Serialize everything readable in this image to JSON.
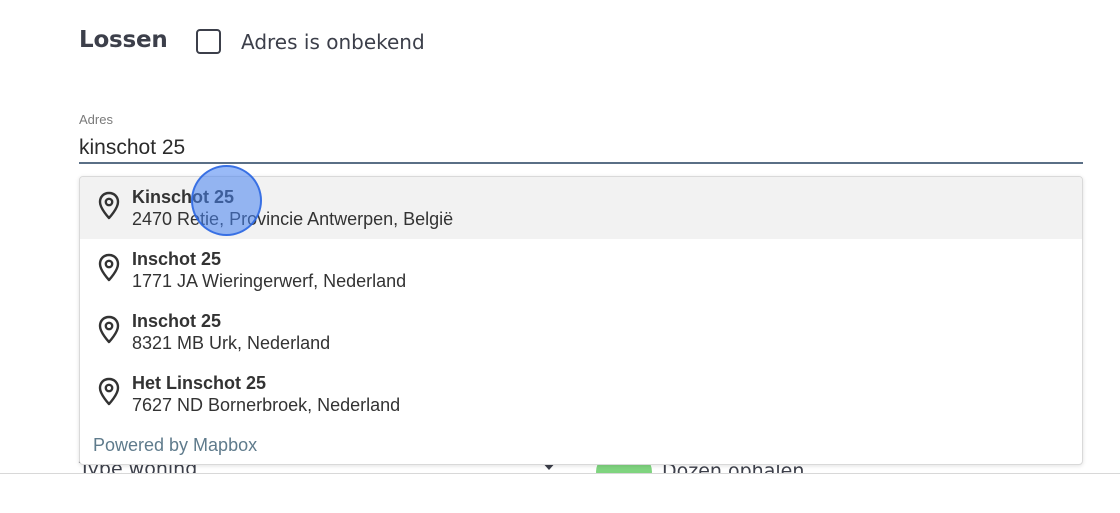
{
  "section": {
    "title": "Lossen",
    "unknown_address_label": "Adres is onbekend",
    "unknown_address_checked": false
  },
  "address": {
    "label": "Adres",
    "value": "kinschot 25"
  },
  "suggestions": [
    {
      "title": "Kinschot 25",
      "subtitle": "2470 Retie, Provincie Antwerpen, België",
      "icon": "map-pin-icon"
    },
    {
      "title": "Inschot 25",
      "subtitle": "1771 JA Wieringerwerf, Nederland",
      "icon": "map-pin-icon"
    },
    {
      "title": "Inschot 25",
      "subtitle": "8321 MB Urk, Nederland",
      "icon": "map-pin-icon"
    },
    {
      "title": "Het Linschot 25",
      "subtitle": "7627 ND Bornerbroek, Nederland",
      "icon": "map-pin-icon"
    }
  ],
  "powered_by": "Powered by Mapbox",
  "background_form": {
    "type_label": "Type woning",
    "toggle_label": "Dozen ophalen"
  },
  "colors": {
    "click_indicator": "#4682f0",
    "toggle_on": "#7fd47f",
    "input_underline": "#5a6f86",
    "active_suggestion": "#f2f2f2"
  }
}
